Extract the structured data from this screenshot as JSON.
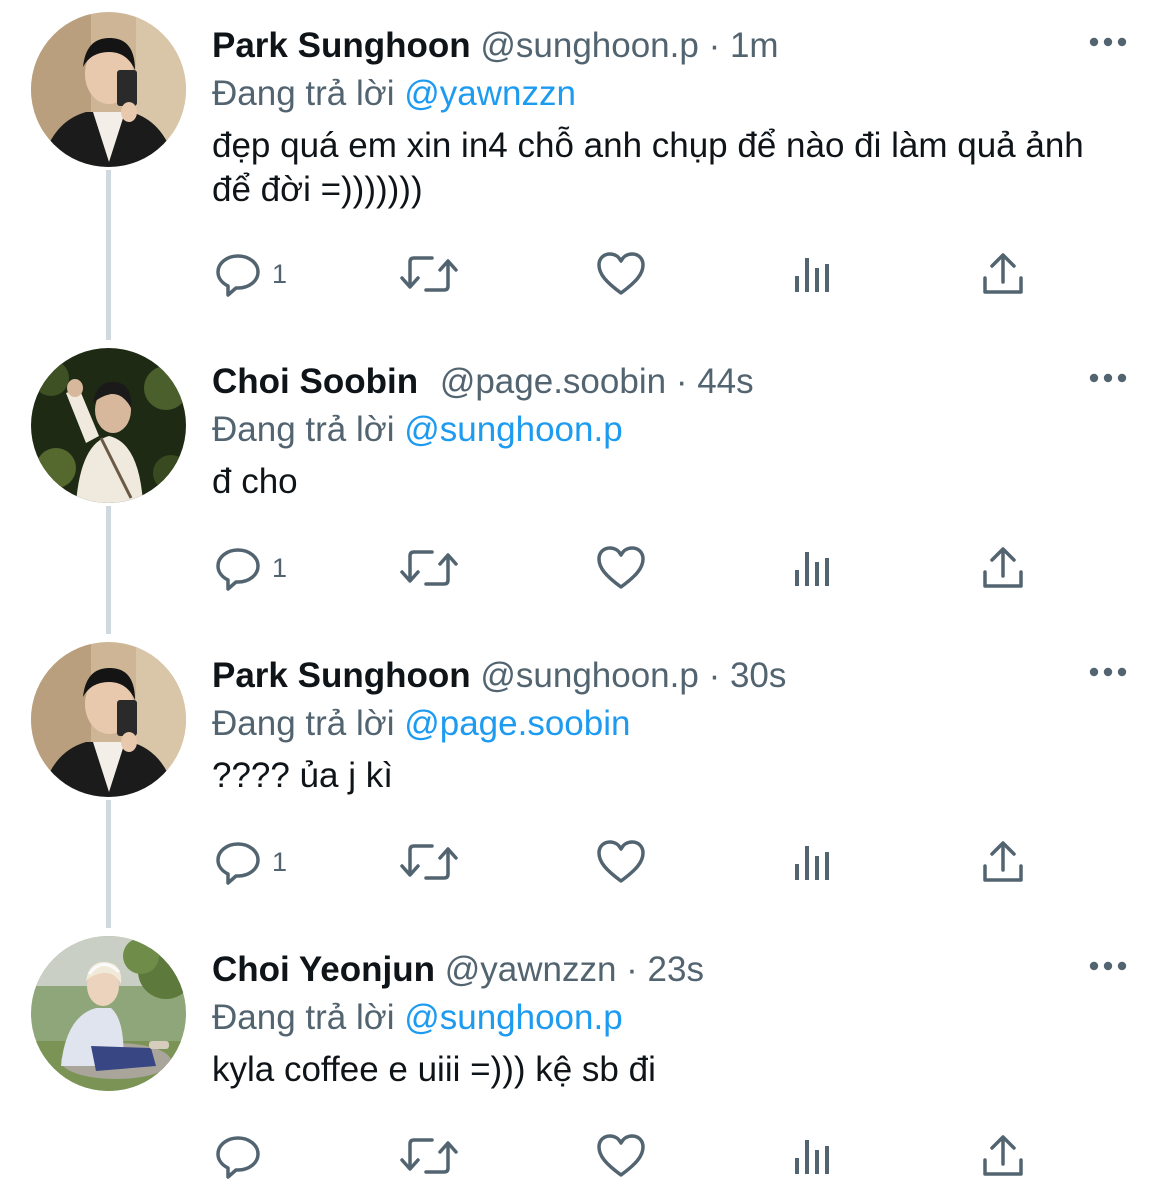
{
  "reply_prefix": "Đang trả lời",
  "tweets": [
    {
      "name": "Park Sunghoon",
      "handle": "@sunghoon.p",
      "separator": "·",
      "time": "1m",
      "reply_to": "@yawnzzn",
      "text": "đẹp quá em xin in4 chỗ anh chụp để nào đi làm quả ảnh để đời =)))))))",
      "reply_count": "1",
      "avatar": "park-sunghoon"
    },
    {
      "name": "Choi Soobin",
      "handle": "@page.soobin",
      "separator": "·",
      "time": "44s",
      "reply_to": "@sunghoon.p",
      "text": "đ cho",
      "reply_count": "1",
      "avatar": "choi-soobin"
    },
    {
      "name": "Park Sunghoon",
      "handle": "@sunghoon.p",
      "separator": "·",
      "time": "30s",
      "reply_to": "@page.soobin",
      "text": "???? ủa j kì",
      "reply_count": "1",
      "avatar": "park-sunghoon"
    },
    {
      "name": "Choi Yeonjun",
      "handle": "@yawnzzn",
      "separator": "·",
      "time": "23s",
      "reply_to": "@sunghoon.p",
      "text": "kyla coffee e uiii =))) kệ sb đi",
      "reply_count": "",
      "avatar": "choi-yeonjun"
    }
  ],
  "icons": {
    "reply": "reply-icon",
    "retweet": "retweet-icon",
    "like": "heart-icon",
    "views": "views-icon",
    "share": "share-icon",
    "more": "more-icon"
  },
  "colors": {
    "text": "#0f1419",
    "secondary": "#536471",
    "link": "#1d9bf0",
    "thread_line": "#cfd9de"
  }
}
